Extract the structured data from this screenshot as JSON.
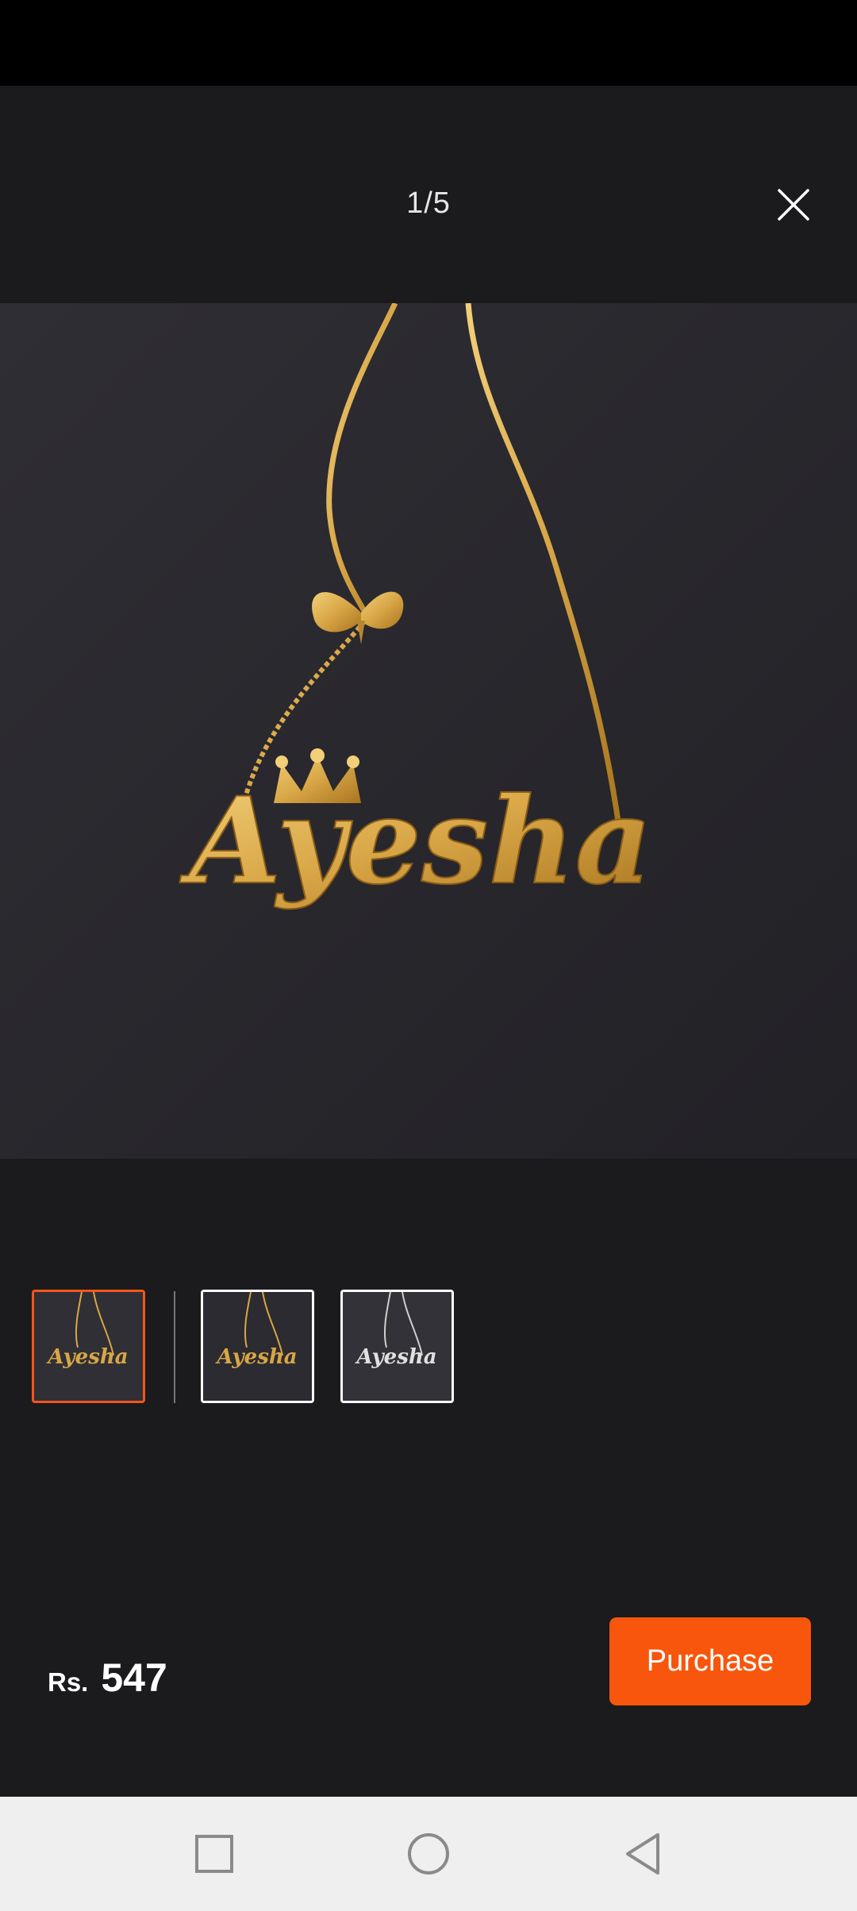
{
  "viewer": {
    "counter": "1/5"
  },
  "product": {
    "name_on_pendant": "Ayesha",
    "currency": "Rs.",
    "price": "547"
  },
  "actions": {
    "purchase_label": "Purchase"
  },
  "thumbnails": [
    {
      "label": "Ayesha",
      "active": true,
      "tone": "gold"
    },
    {
      "label": "Ayesha",
      "active": false,
      "tone": "gold"
    },
    {
      "label": "Ayesha",
      "active": false,
      "tone": "silver"
    }
  ],
  "colors": {
    "accent": "#f7560c",
    "active_border": "#f2561a",
    "background": "#1b1a1c",
    "gold": "#d8a646"
  },
  "icons": {
    "close": "close-icon",
    "nav_recent": "square-icon",
    "nav_home": "circle-icon",
    "nav_back": "triangle-back-icon"
  }
}
